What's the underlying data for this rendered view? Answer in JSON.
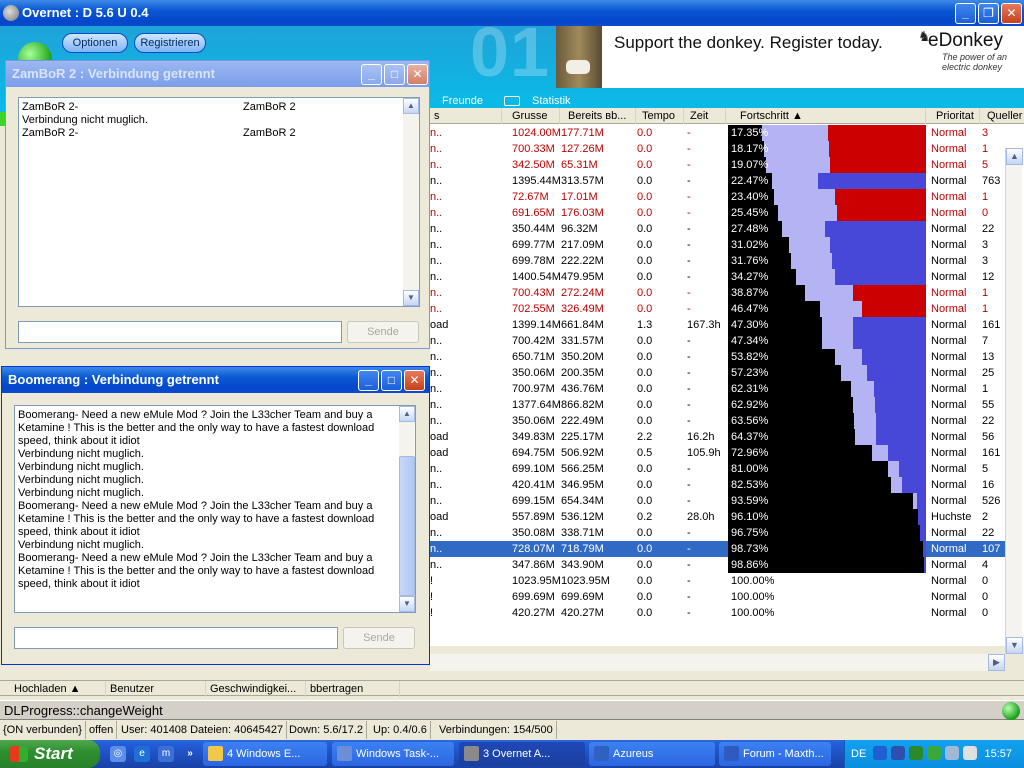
{
  "app": {
    "title": "Overnet : D 5.6 U 0.4"
  },
  "toolbar": {
    "optionen": "Optionen",
    "registrieren": "Registrieren"
  },
  "banner": {
    "slogan": "Support the donkey. Register today.",
    "brand": "eDonkey",
    "brand_sub": "The power of an electric donkey"
  },
  "tabs": {
    "freunde": "Freunde",
    "statistik": "Statistik"
  },
  "columns": {
    "name": "s",
    "groesse": "Grusse",
    "bereits": "Bereits вb...",
    "tempo": "Tempo",
    "zeit": "Zeit",
    "fortschritt": "Fortschritt",
    "prioritaet": "Prioritat",
    "quellen": "Queller"
  },
  "downloads": [
    {
      "name": "n..",
      "size": "1024.00M",
      "done": "177.71M",
      "speed": "0.0",
      "time": "-",
      "progress": "17.35%",
      "frac": 0.1735,
      "prio": "Normal",
      "src": "3",
      "red": true
    },
    {
      "name": "n..",
      "size": "700.33M",
      "done": "127.26M",
      "speed": "0.0",
      "time": "-",
      "progress": "18.17%",
      "frac": 0.1817,
      "prio": "Normal",
      "src": "1",
      "red": true
    },
    {
      "name": "n..",
      "size": "342.50M",
      "done": "65.31M",
      "speed": "0.0",
      "time": "-",
      "progress": "19.07%",
      "frac": 0.1907,
      "prio": "Normal",
      "src": "5",
      "red": true
    },
    {
      "name": "n..",
      "size": "1395.44M",
      "done": "313.57M",
      "speed": "0.0",
      "time": "-",
      "progress": "22.47%",
      "frac": 0.2247,
      "prio": "Normal",
      "src": "763",
      "red": false
    },
    {
      "name": "n..",
      "size": "72.67M",
      "done": "17.01M",
      "speed": "0.0",
      "time": "-",
      "progress": "23.40%",
      "frac": 0.234,
      "prio": "Normal",
      "src": "1",
      "red": true
    },
    {
      "name": "n..",
      "size": "691.65M",
      "done": "176.03M",
      "speed": "0.0",
      "time": "-",
      "progress": "25.45%",
      "frac": 0.2545,
      "prio": "Normal",
      "src": "0",
      "red": true
    },
    {
      "name": "n..",
      "size": "350.44M",
      "done": "96.32M",
      "speed": "0.0",
      "time": "-",
      "progress": "27.48%",
      "frac": 0.2748,
      "prio": "Normal",
      "src": "22",
      "red": false
    },
    {
      "name": "n..",
      "size": "699.77M",
      "done": "217.09M",
      "speed": "0.0",
      "time": "-",
      "progress": "31.02%",
      "frac": 0.3102,
      "prio": "Normal",
      "src": "3",
      "red": false
    },
    {
      "name": "n..",
      "size": "699.78M",
      "done": "222.22M",
      "speed": "0.0",
      "time": "-",
      "progress": "31.76%",
      "frac": 0.3176,
      "prio": "Normal",
      "src": "3",
      "red": false
    },
    {
      "name": "n..",
      "size": "1400.54M",
      "done": "479.95M",
      "speed": "0.0",
      "time": "-",
      "progress": "34.27%",
      "frac": 0.3427,
      "prio": "Normal",
      "src": "12",
      "red": false
    },
    {
      "name": "n..",
      "size": "700.43M",
      "done": "272.24M",
      "speed": "0.0",
      "time": "-",
      "progress": "38.87%",
      "frac": 0.3887,
      "prio": "Normal",
      "src": "1",
      "red": true
    },
    {
      "name": "n..",
      "size": "702.55M",
      "done": "326.49M",
      "speed": "0.0",
      "time": "-",
      "progress": "46.47%",
      "frac": 0.4647,
      "prio": "Normal",
      "src": "1",
      "red": true
    },
    {
      "name": "oad",
      "size": "1399.14M",
      "done": "661.84M",
      "speed": "1.3",
      "time": "167.3h",
      "progress": "47.30%",
      "frac": 0.473,
      "prio": "Normal",
      "src": "161",
      "red": false
    },
    {
      "name": "n..",
      "size": "700.42M",
      "done": "331.57M",
      "speed": "0.0",
      "time": "-",
      "progress": "47.34%",
      "frac": 0.4734,
      "prio": "Normal",
      "src": "7",
      "red": false
    },
    {
      "name": "n..",
      "size": "650.71M",
      "done": "350.20M",
      "speed": "0.0",
      "time": "-",
      "progress": "53.82%",
      "frac": 0.5382,
      "prio": "Normal",
      "src": "13",
      "red": false
    },
    {
      "name": "n..",
      "size": "350.06M",
      "done": "200.35M",
      "speed": "0.0",
      "time": "-",
      "progress": "57.23%",
      "frac": 0.5723,
      "prio": "Normal",
      "src": "25",
      "red": false
    },
    {
      "name": "n..",
      "size": "700.97M",
      "done": "436.76M",
      "speed": "0.0",
      "time": "-",
      "progress": "62.31%",
      "frac": 0.6231,
      "prio": "Normal",
      "src": "1",
      "red": false
    },
    {
      "name": "n..",
      "size": "1377.64M",
      "done": "866.82M",
      "speed": "0.0",
      "time": "-",
      "progress": "62.92%",
      "frac": 0.6292,
      "prio": "Normal",
      "src": "55",
      "red": false
    },
    {
      "name": "n..",
      "size": "350.06M",
      "done": "222.49M",
      "speed": "0.0",
      "time": "-",
      "progress": "63.56%",
      "frac": 0.6356,
      "prio": "Normal",
      "src": "22",
      "red": false
    },
    {
      "name": "oad",
      "size": "349.83M",
      "done": "225.17M",
      "speed": "2.2",
      "time": "16.2h",
      "progress": "64.37%",
      "frac": 0.6437,
      "prio": "Normal",
      "src": "56",
      "red": false
    },
    {
      "name": "oad",
      "size": "694.75M",
      "done": "506.92M",
      "speed": "0.5",
      "time": "105.9h",
      "progress": "72.96%",
      "frac": 0.7296,
      "prio": "Normal",
      "src": "161",
      "red": false
    },
    {
      "name": "n..",
      "size": "699.10M",
      "done": "566.25M",
      "speed": "0.0",
      "time": "-",
      "progress": "81.00%",
      "frac": 0.81,
      "prio": "Normal",
      "src": "5",
      "red": false
    },
    {
      "name": "n..",
      "size": "420.41M",
      "done": "346.95M",
      "speed": "0.0",
      "time": "-",
      "progress": "82.53%",
      "frac": 0.8253,
      "prio": "Normal",
      "src": "16",
      "red": false
    },
    {
      "name": "n..",
      "size": "699.15M",
      "done": "654.34M",
      "speed": "0.0",
      "time": "-",
      "progress": "93.59%",
      "frac": 0.9359,
      "prio": "Normal",
      "src": "526",
      "red": false
    },
    {
      "name": "oad",
      "size": "557.89M",
      "done": "536.12M",
      "speed": "0.2",
      "time": "28.0h",
      "progress": "96.10%",
      "frac": 0.961,
      "prio": "Huchste",
      "src": "2",
      "red": false
    },
    {
      "name": "n..",
      "size": "350.08M",
      "done": "338.71M",
      "speed": "0.0",
      "time": "-",
      "progress": "96.75%",
      "frac": 0.9675,
      "prio": "Normal",
      "src": "22",
      "red": false
    },
    {
      "name": "n..",
      "size": "728.07M",
      "done": "718.79M",
      "speed": "0.0",
      "time": "-",
      "progress": "98.73%",
      "frac": 0.9873,
      "prio": "Normal",
      "src": "107",
      "red": false,
      "selected": true
    },
    {
      "name": "n..",
      "size": "347.86M",
      "done": "343.90M",
      "speed": "0.0",
      "time": "-",
      "progress": "98.86%",
      "frac": 0.9886,
      "prio": "Normal",
      "src": "4",
      "red": false
    },
    {
      "name": "!",
      "size": "1023.95M",
      "done": "1023.95M",
      "speed": "0.0",
      "time": "-",
      "progress": "100.00%",
      "frac": 1.0,
      "prio": "Normal",
      "src": "0",
      "red": false
    },
    {
      "name": "!",
      "size": "699.69M",
      "done": "699.69M",
      "speed": "0.0",
      "time": "-",
      "progress": "100.00%",
      "frac": 1.0,
      "prio": "Normal",
      "src": "0",
      "red": false
    },
    {
      "name": "!",
      "size": "420.27M",
      "done": "420.27M",
      "speed": "0.0",
      "time": "-",
      "progress": "100.00%",
      "frac": 1.0,
      "prio": "Normal",
      "src": "0",
      "red": false
    }
  ],
  "bottom_columns": {
    "hochladen": "Hochladen",
    "benutzer": "Benutzer",
    "geschwindigkeit": "Geschwindigkei...",
    "uebertragen": "bbertragen"
  },
  "status": {
    "line1": "DLProgress::changeWeight",
    "verbunden": "{ON verbunden}",
    "offen": "offen",
    "user": "User: 401408 Dateien: 40645427",
    "down": "Down: 5.6/17.2",
    "up": "Up: 0.4/0.6",
    "verbindungen": "Verbindungen: 154/500"
  },
  "chat1": {
    "title": "ZamBoR 2 : Verbindung getrennt",
    "lines": [
      {
        "left": "ZamBoR 2-",
        "right": "ZamBoR 2"
      },
      {
        "left": "Verbindung nicht muglich.",
        "right": ""
      },
      {
        "left": "ZamBoR 2-",
        "right": "ZamBoR 2"
      }
    ],
    "send": "Sende"
  },
  "chat2": {
    "title": "Boomerang : Verbindung getrennt",
    "lines": [
      "Boomerang- Need a new eMule Mod ? Join the L33cher Team and buy a",
      "Ketamine ! This is the better and the only way to have a fastest download",
      "speed, think about it idiot",
      "Verbindung nicht muglich.",
      "Verbindung nicht muglich.",
      "Verbindung nicht muglich.",
      "Verbindung nicht muglich.",
      "Boomerang- Need a new eMule Mod ? Join the L33cher Team and buy a",
      "Ketamine ! This is the better and the only way to have a fastest download",
      "speed, think about it idiot",
      "Verbindung nicht muglich.",
      "Boomerang- Need a new eMule Mod ? Join the L33cher Team and buy a",
      "Ketamine ! This is the better and the only way to have a fastest download",
      "speed, think about it idiot"
    ],
    "send": "Sende"
  },
  "taskbar": {
    "start": "Start",
    "tasks": [
      {
        "label": "4 Windows E...",
        "active": false
      },
      {
        "label": "Windows Task-...",
        "active": false
      },
      {
        "label": "3 Overnet A...",
        "active": true
      },
      {
        "label": "Azureus",
        "active": false
      },
      {
        "label": "Forum - Maxth...",
        "active": false
      }
    ],
    "lang": "DE",
    "clock": "15:57"
  },
  "colors": {
    "bar_light": "#b4b4f4",
    "bar_blue": "#4848d8",
    "bar_red": "#cc0000",
    "selection": "#316ac5",
    "tool_band": "#0fb2e6",
    "green_strip": "#3cd42a"
  }
}
